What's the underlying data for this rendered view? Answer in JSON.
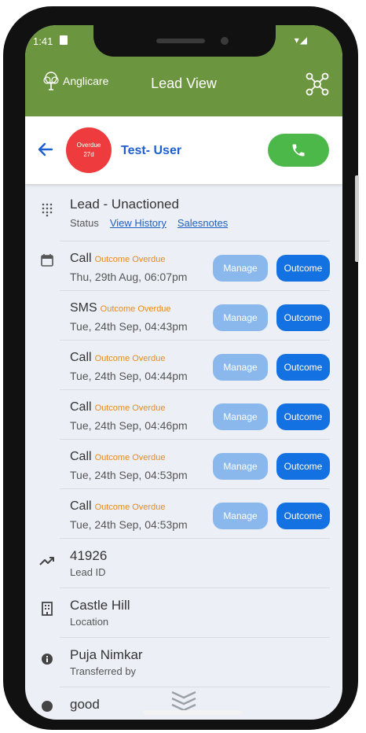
{
  "status_bar": {
    "time": "1:41",
    "right_icons": "▾◢"
  },
  "header": {
    "brand": "Anglicare",
    "title": "Lead View"
  },
  "user": {
    "avatar_line1": "Overdue",
    "avatar_line2": "27d",
    "name": "Test- User"
  },
  "lead": {
    "title": "Lead - Unactioned",
    "status_label": "Status",
    "view_history": "View History",
    "salesnotes": "Salesnotes"
  },
  "buttons": {
    "manage": "Manage",
    "outcome": "Outcome"
  },
  "activities": [
    {
      "type": "Call",
      "badge": "Outcome Overdue",
      "datetime": "Thu, 29th Aug, 06:07pm"
    },
    {
      "type": "SMS",
      "badge": "Outcome Overdue",
      "datetime": "Tue, 24th Sep, 04:43pm"
    },
    {
      "type": "Call",
      "badge": "Outcome Overdue",
      "datetime": "Tue, 24th Sep, 04:44pm"
    },
    {
      "type": "Call",
      "badge": "Outcome Overdue",
      "datetime": "Tue, 24th Sep, 04:46pm"
    },
    {
      "type": "Call",
      "badge": "Outcome Overdue",
      "datetime": "Tue, 24th Sep, 04:53pm"
    },
    {
      "type": "Call",
      "badge": "Outcome Overdue",
      "datetime": "Tue, 24th Sep, 04:53pm"
    }
  ],
  "details": [
    {
      "value": "41926",
      "label": "Lead ID"
    },
    {
      "value": "Castle Hill",
      "label": "Location"
    },
    {
      "value": "Puja Nimkar",
      "label": "Transferred by"
    },
    {
      "value": "good",
      "label": ""
    }
  ],
  "colors": {
    "header_green": "#6c953f",
    "overdue_red": "#ee3b3e",
    "call_green": "#4cb84a",
    "outcome_blue": "#1471e2",
    "manage_blue": "#8ab8ec",
    "badge_orange": "#e98a17"
  }
}
